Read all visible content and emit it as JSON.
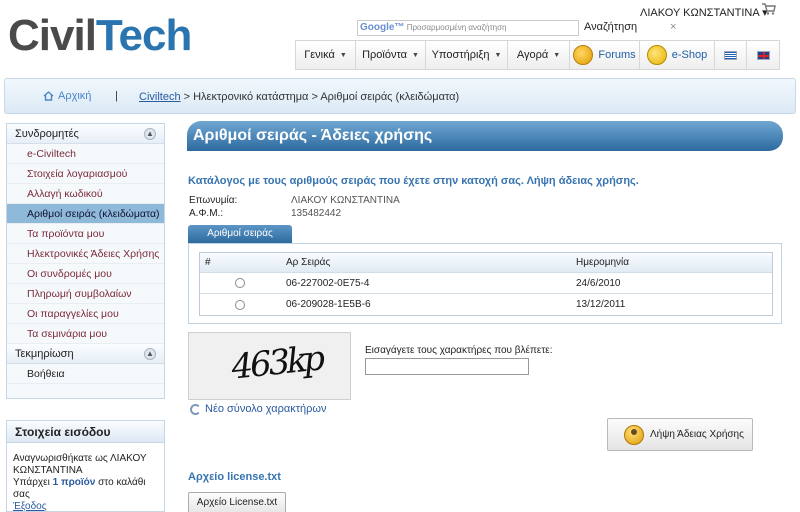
{
  "header": {
    "logo_text_a": "Civil",
    "logo_text_b": "Tech",
    "user_name": "ΛΙΑΚΟΥ ΚΩΝΣΤΑΝΤΙΝΑ ▾",
    "search": {
      "brand": "Google™",
      "placeholder": "Προσαρμοσμένη αναζήτηση",
      "button": "Αναζήτηση",
      "close": "×"
    }
  },
  "nav": {
    "items": [
      {
        "label": "Γενικά",
        "caret": "▼"
      },
      {
        "label": "Προϊόντα",
        "caret": "▼"
      },
      {
        "label": "Υποστήριξη",
        "caret": "▼"
      },
      {
        "label": "Αγορά",
        "caret": "▼"
      },
      {
        "label": "Forums",
        "icon": "forums-icon"
      },
      {
        "label": "e-Shop",
        "icon": "shop-icon"
      }
    ],
    "flags": [
      "greek-flag-icon",
      "uk-flag-icon"
    ]
  },
  "breadcrumb": {
    "home": "Αρχική",
    "separator": "|",
    "root_link": "Civiltech",
    "rest": " > Ηλεκτρονικό κατάστημα > Αριθμοί σειράς (κλειδώματα)"
  },
  "sidebar": {
    "section1": "Συνδρομητές",
    "items": [
      {
        "label": "e-Civiltech"
      },
      {
        "label": "Στοιχεία λογαριασμού"
      },
      {
        "label": "Αλλαγή κωδικού"
      },
      {
        "label": "Αριθμοί σειράς (κλειδώματα)",
        "active": true
      },
      {
        "label": "Τα προϊόντα μου"
      },
      {
        "label": "Ηλεκτρονικές Άδειες Χρήσης"
      },
      {
        "label": "Οι συνδρομές μου"
      },
      {
        "label": "Πληρωμή συμβολαίων"
      },
      {
        "label": "Οι παραγγελίες μου"
      },
      {
        "label": "Τα σεμινάρια μου"
      }
    ],
    "section2": "Τεκμηρίωση",
    "section2_items": [
      {
        "label": "Βοήθεια"
      }
    ]
  },
  "login": {
    "title": "Στοιχεία εισόδου",
    "line1": "Αναγνωρισθήκατε ως ΛΙΑΚΟΥ ΚΩΝΣΤΑΝΤΙΝΑ",
    "line2_a": "Υπάρχει ",
    "line2_b": "1 προϊόν",
    "line2_c": " στο καλάθι σας",
    "logout": "Έξοδος"
  },
  "main": {
    "title": "Αριθμοί σειράς - Άδειες χρήσης",
    "subtitle": "Κατάλογος με τους αριθμούς σειράς που έχετε στην κατοχή σας. Λήψη άδειας χρήσης.",
    "info": [
      {
        "key": "Επωνυμία:",
        "value": "ΛΙΑΚΟΥ ΚΩΝΣΤΑΝΤΙΝΑ"
      },
      {
        "key": "Α.Φ.Μ.:",
        "value": "135482442"
      }
    ],
    "tab": "Αριθμοί σειράς",
    "table": {
      "headers": [
        "#",
        "Αρ Σειράς",
        "Ημερομηνία"
      ],
      "rows": [
        {
          "serial": "06-227002-0E75-4",
          "date": "24/6/2010"
        },
        {
          "serial": "06-209028-1E5B-6",
          "date": "13/12/2011"
        }
      ]
    },
    "captcha": {
      "image_text": "463kp",
      "label": "Εισαγάγετε τους χαρακτήρες που βλέπετε:",
      "value": "",
      "new_set": "Νέο σύνολο χαρακτήρων"
    },
    "license_button": "Λήψη Άδειας Χρήσης",
    "file_title": "Αρχείο license.txt",
    "file_button": "Αρχείο License.txt"
  }
}
